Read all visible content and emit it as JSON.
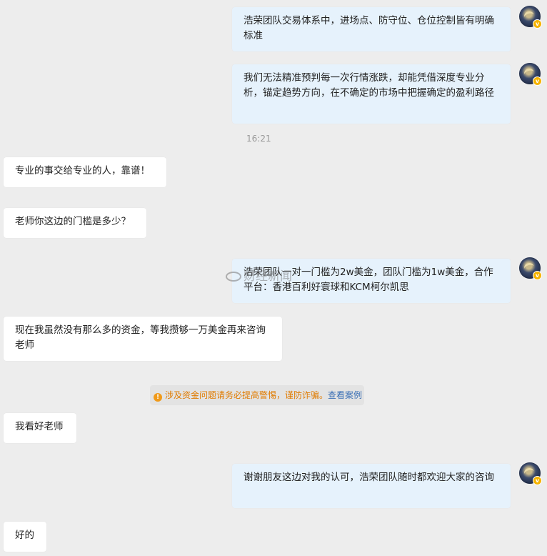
{
  "messages": [
    {
      "text": "浩荣团队交易体系中，进场点、防守位、仓位控制皆有明确标准"
    },
    {
      "text": "我们无法精准预判每一次行情涨跌，却能凭借深度专业分析，锚定趋势方向，在不确定的市场中把握确定的盈利路径"
    },
    {
      "text": "专业的事交给专业的人，靠谱！"
    },
    {
      "text": "老师你这边的门槛是多少？"
    },
    {
      "text": "浩荣团队一对一门槛为2w美金，团队门槛为1w美金，合作平台：香港百利好寰球和KCM柯尔凯思"
    },
    {
      "text": "现在我虽然没有那么多的资金，等我攒够一万美金再来咨询老师"
    },
    {
      "text": "我看好老师"
    },
    {
      "text": "谢谢朋友这边对我的认可，浩荣团队随时都欢迎大家的咨询"
    },
    {
      "text": "好的"
    }
  ],
  "timestamp": "16:21",
  "warning": {
    "icon": "!",
    "text": "涉及资金问题请务必提高警惕，谨防诈骗。",
    "link": "查看案例"
  },
  "watermark": {
    "text": "财经新闻"
  },
  "avatar_badge": "v",
  "colors": {
    "background": "#ededed",
    "right_bubble": "#e6f2fc",
    "left_bubble": "#ffffff",
    "warning_text": "#e07b00",
    "link": "#3a6fb5"
  }
}
